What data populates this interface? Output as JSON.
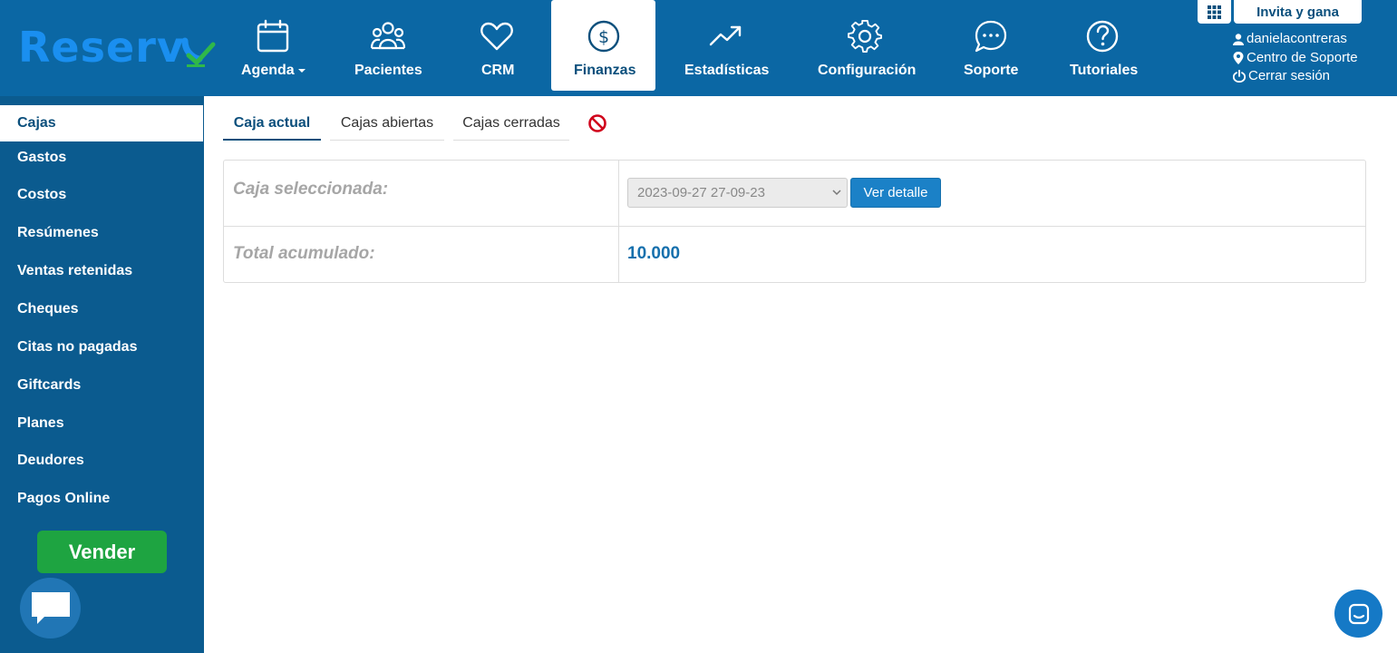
{
  "brand": {
    "name": "Reserv",
    "accent": "#1a8ff0",
    "check_color": "#2fb84a"
  },
  "nav": {
    "items": [
      {
        "label": "Agenda",
        "icon": "calendar-icon"
      },
      {
        "label": "Pacientes",
        "icon": "users-icon"
      },
      {
        "label": "CRM",
        "icon": "heart-icon"
      },
      {
        "label": "Finanzas",
        "icon": "dollar-circle-icon"
      },
      {
        "label": "Estadísticas",
        "icon": "trend-up-icon"
      },
      {
        "label": "Configuración",
        "icon": "gear-icon"
      },
      {
        "label": "Soporte",
        "icon": "chat-dots-icon"
      },
      {
        "label": "Tutoriales",
        "icon": "question-circle-icon"
      }
    ],
    "active": "Finanzas"
  },
  "header": {
    "invite_label": "Invita y gana",
    "username": "danielacontreras",
    "support_center": "Centro de Soporte",
    "logout": "Cerrar sesión"
  },
  "sidebar": {
    "items": [
      {
        "label": "Cajas"
      },
      {
        "label": "Gastos"
      },
      {
        "label": "Costos"
      },
      {
        "label": "Resúmenes"
      },
      {
        "label": "Ventas retenidas"
      },
      {
        "label": "Cheques"
      },
      {
        "label": "Citas no pagadas"
      },
      {
        "label": "Giftcards"
      },
      {
        "label": "Planes"
      },
      {
        "label": "Deudores"
      },
      {
        "label": "Pagos Online"
      }
    ],
    "active": "Cajas",
    "vender_label": "Vender"
  },
  "tabs": {
    "items": [
      {
        "label": "Caja actual"
      },
      {
        "label": "Cajas abiertas"
      },
      {
        "label": "Cajas cerradas"
      }
    ],
    "active": "Caja actual"
  },
  "panel": {
    "selected_label": "Caja seleccionada:",
    "selected_value": "2023-09-27 27-09-23",
    "detail_button": "Ver detalle",
    "total_label": "Total acumulado:",
    "total_value": "10.000"
  },
  "colors": {
    "topbar": "#0b67a4",
    "sidebar": "#0b5b8f",
    "vender": "#1ea441",
    "primary_button": "#1b81c7",
    "block_icon": "#d0021b"
  }
}
